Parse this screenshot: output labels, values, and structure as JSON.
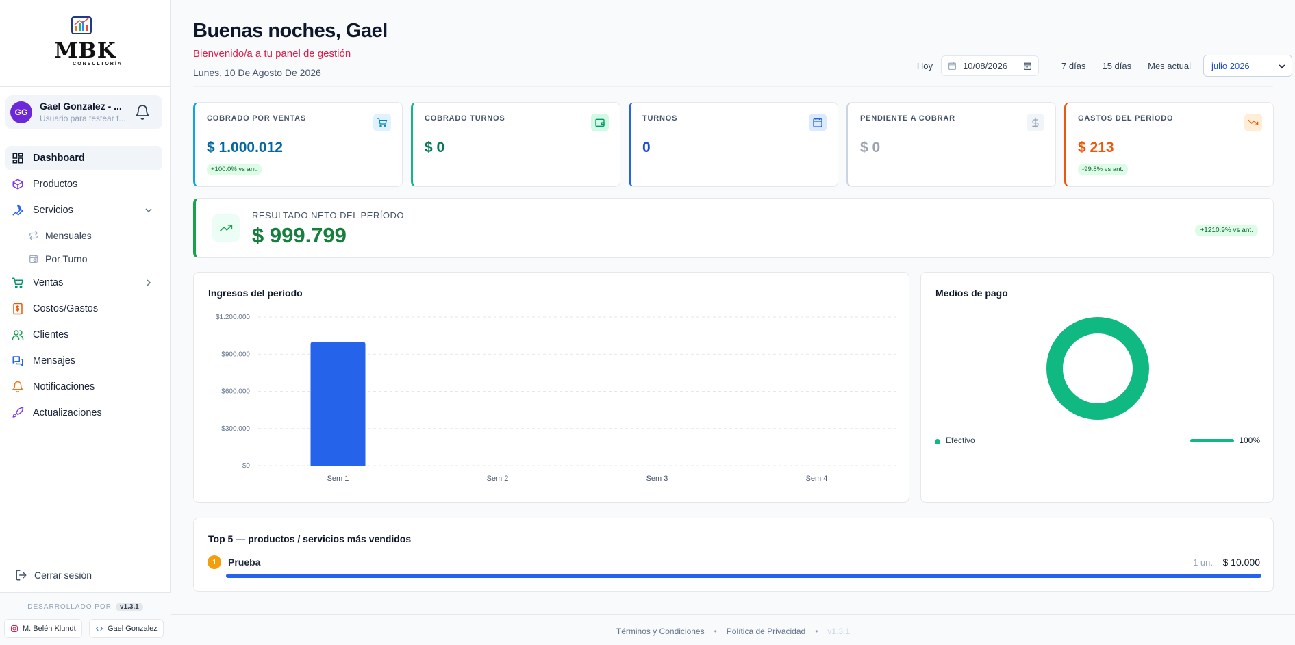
{
  "sidebar": {
    "logo": {
      "text": "MBK",
      "sub": "CONSULTORÍA"
    },
    "user": {
      "initials": "GG",
      "name": "Gael Gonzalez - ...",
      "description": "Usuario para testear f..."
    },
    "nav": [
      {
        "label": "Dashboard",
        "icon": "dashboard-icon"
      },
      {
        "label": "Productos",
        "icon": "box-icon"
      },
      {
        "label": "Servicios",
        "icon": "wrench-icon"
      },
      {
        "label": "Mensuales",
        "icon": "repeat-icon"
      },
      {
        "label": "Por Turno",
        "icon": "calendar-clock-icon"
      },
      {
        "label": "Ventas",
        "icon": "cart-icon"
      },
      {
        "label": "Costos/Gastos",
        "icon": "receipt-icon"
      },
      {
        "label": "Clientes",
        "icon": "users-icon"
      },
      {
        "label": "Mensajes",
        "icon": "messages-icon"
      },
      {
        "label": "Notificaciones",
        "icon": "bell-icon"
      },
      {
        "label": "Actualizaciones",
        "icon": "rocket-icon"
      }
    ],
    "logout": "Cerrar sesión",
    "developed_by": "DESARROLLADO POR",
    "version": "v1.3.1",
    "credits": [
      "M. Belén Klundt",
      "Gael Gonzalez"
    ]
  },
  "header": {
    "greeting": "Buenas noches, Gael",
    "welcome": "Bienvenido/a a tu panel de gestión",
    "date": "Lunes, 10 De Agosto De 2026"
  },
  "filters": {
    "today": "Hoy",
    "date_value": "10/08/2026",
    "days7": "7 días",
    "days15": "15 días",
    "current_month": "Mes actual",
    "month_selected": "julio 2026"
  },
  "kpis": [
    {
      "title": "COBRADO POR VENTAS",
      "value": "$ 1.000.012",
      "badge": "+100.0% vs ant.",
      "color": "#0369a1",
      "border": "#0ea5e9"
    },
    {
      "title": "COBRADO TURNOS",
      "value": "$ 0",
      "badge": "",
      "color": "#047857",
      "border": "#10b981"
    },
    {
      "title": "TURNOS",
      "value": "0",
      "badge": "",
      "color": "#1d4ed8",
      "border": "#2563eb"
    },
    {
      "title": "PENDIENTE A COBRAR",
      "value": "$ 0",
      "badge": "",
      "color": "#9ca3af",
      "border": "#cbd5e1"
    },
    {
      "title": "GASTOS DEL PERÍODO",
      "value": "$ 213",
      "badge": "-99.8% vs ant.",
      "color": "#ea580c",
      "border": "#ea580c"
    }
  ],
  "net": {
    "title": "RESULTADO NETO DEL PERÍODO",
    "value": "$ 999.799",
    "badge": "+1210.9% vs ant."
  },
  "income": {
    "title": "Ingresos del período"
  },
  "payments": {
    "title": "Medios de pago",
    "legend_label": "Efectivo",
    "legend_pct": "100%"
  },
  "top": {
    "title": "Top 5 — productos / servicios más vendidos",
    "items": [
      {
        "rank": "1",
        "name": "Prueba",
        "units": "1 un.",
        "amount": "$ 10.000",
        "share": 1.0
      }
    ]
  },
  "footer": {
    "terms": "Términos y Condiciones",
    "privacy": "Política de Privacidad",
    "version": "v1.3.1"
  },
  "chart_data": [
    {
      "type": "bar",
      "title": "Ingresos del período",
      "categories": [
        "Sem 1",
        "Sem 2",
        "Sem 3",
        "Sem 4"
      ],
      "values": [
        1000012,
        0,
        0,
        0
      ],
      "ylim": [
        0,
        1200000
      ],
      "yticks": [
        0,
        300000,
        600000,
        900000,
        1200000
      ],
      "ytick_labels": [
        "$0",
        "$300.000",
        "$600.000",
        "$900.000",
        "$1.200.000"
      ],
      "grid": true,
      "color": "#2563eb"
    },
    {
      "type": "pie",
      "title": "Medios de pago",
      "labels": [
        "Efectivo"
      ],
      "values": [
        100
      ],
      "colors": [
        "#10b981"
      ],
      "donut": true
    }
  ]
}
